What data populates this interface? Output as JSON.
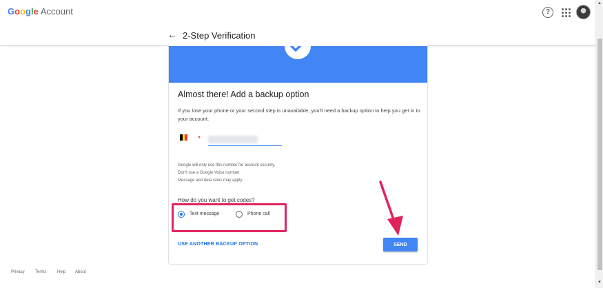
{
  "header": {
    "logo_brand": "Google",
    "logo_suffix": "Account",
    "help_icon": "help-circle-icon",
    "apps_icon": "apps-grid-icon"
  },
  "card": {
    "title": "2-Step Verification",
    "heading": "Almost there! Add a backup option",
    "description": "If you lose your phone or your second step is unavailable, you'll need a backup option to help you get in to your account.",
    "phone": {
      "country_flag": "belgium-flag",
      "value": "•• ••• •• ••"
    },
    "notes": [
      "Google will only use this number for account security.",
      "Don't use a Google Voice number.",
      "Message and data rates may apply."
    ],
    "question": "How do you want to get codes?",
    "options": [
      {
        "label": "Text message",
        "selected": true
      },
      {
        "label": "Phone call",
        "selected": false
      }
    ],
    "another_option_link": "USE ANOTHER BACKUP OPTION",
    "send_button": "SEND"
  },
  "footer": {
    "links": [
      "Privacy",
      "Terms",
      "Help",
      "About"
    ]
  },
  "colors": {
    "accent": "#4285f4",
    "highlight": "#e0245e",
    "arrow": "#e0245e"
  }
}
